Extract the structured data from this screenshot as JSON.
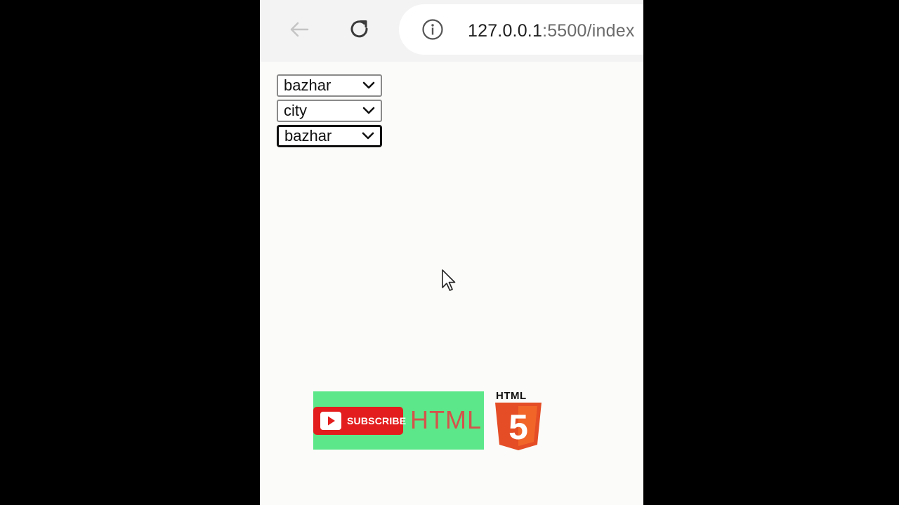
{
  "browser": {
    "url_host": "127.0.0.1",
    "url_rest": ":5500/index"
  },
  "selects": [
    {
      "value": "bazhar"
    },
    {
      "value": "city"
    },
    {
      "value": "bazhar"
    }
  ],
  "banner": {
    "subscribe_label": "SUBSCRIBE",
    "text": "HTML"
  },
  "logo": {
    "label": "HTML",
    "digit": "5"
  },
  "colors": {
    "banner_bg": "#5ce88a",
    "subscribe_red": "#e31d1d",
    "html5_orange": "#e44d26",
    "html5_light": "#f16529"
  }
}
